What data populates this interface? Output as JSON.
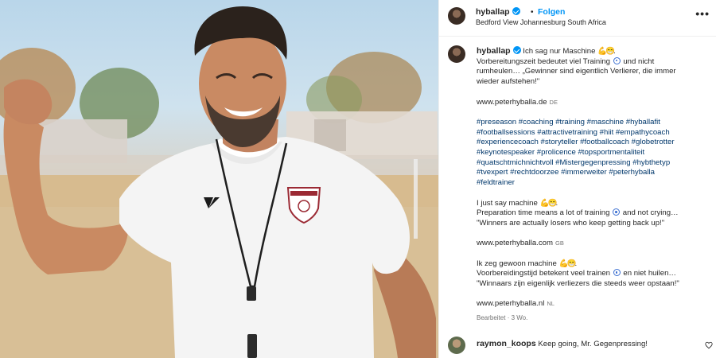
{
  "header": {
    "username": "hyballap",
    "follow_label": "Folgen",
    "location": "Bedford View Johannesburg South Africa",
    "more_label": "•••"
  },
  "caption": {
    "username": "hyballap",
    "de_line1": "Ich sag nur Maschine",
    "de_line2a": "Vorbereitungszeit bedeutet viel Training",
    "de_line2b": "und nicht",
    "de_line3": "rumheulen… „Gewinner sind eigentlich Verlierer, die immer",
    "de_line4": "wieder aufstehen!\"",
    "de_link": "www.peterhyballa.de",
    "de_lang": "DE",
    "hashtags": [
      "#preseason #coaching #training #maschine #hyballafit",
      "#footballsessions #attractivetraining #hiit #empathycoach",
      "#experiencecoach #storyteller #footballcoach #globetrotter",
      "#keynotespeaker #prolicence #topsportmentaliteit",
      "#quatschtmichnichtvoll #Mistergegenpressing #hybthetyp",
      "#tvexpert #rechtdoorzee #immerweiter #peterhyballa",
      "#feldtrainer"
    ],
    "en_line1": "I just say machine",
    "en_line2a": "Preparation time means a lot of training",
    "en_line2b": "and not crying…",
    "en_line3": "\"Winners are actually losers who keep getting back up!\"",
    "en_link": "www.peterhyballa.com",
    "en_lang": "GB",
    "nl_line1": "Ik zeg gewoon machine",
    "nl_line2a": "Voorbereidingstijd betekent veel trainen",
    "nl_line2b": "en niet huilen…",
    "nl_line3": "\"Winnaars zijn eigenlijk verliezers die steeds weer opstaan!\"",
    "nl_link": "www.peterhyballa.nl",
    "nl_lang": "NL",
    "emoji_muscle": "💪",
    "emoji_grin": "😁",
    "meta": "Bearbeitet · 3 Wo."
  },
  "comment": {
    "username": "raymon_koops",
    "text": "Keep going, Mr. Gegenpressing!"
  },
  "colors": {
    "link_blue": "#0095f6",
    "hashtag": "#00376b",
    "muted": "#737373"
  },
  "icons": [
    "verified-badge-icon",
    "more-options-icon",
    "soccer-ball-emoji-icon",
    "heart-icon"
  ]
}
